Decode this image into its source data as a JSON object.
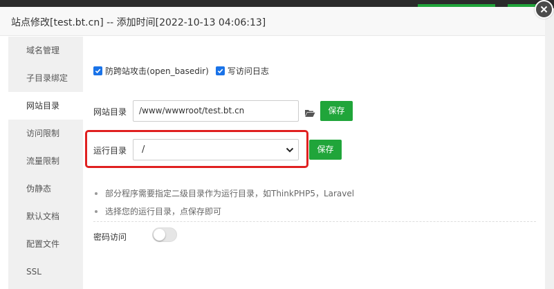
{
  "dialog": {
    "title": "站点修改[test.bt.cn] -- 添加时间[2022-10-13 04:06:13]"
  },
  "sidebar": {
    "items": [
      {
        "label": "域名管理"
      },
      {
        "label": "子目录绑定"
      },
      {
        "label": "网站目录"
      },
      {
        "label": "访问限制"
      },
      {
        "label": "流量限制"
      },
      {
        "label": "伪静态"
      },
      {
        "label": "默认文档"
      },
      {
        "label": "配置文件"
      },
      {
        "label": "SSL"
      }
    ],
    "active": "网站目录"
  },
  "content": {
    "options": {
      "anti_cross_site": {
        "label": "防跨站攻击(open_basedir)",
        "checked": true
      },
      "access_log": {
        "label": "写访问日志",
        "checked": true
      }
    },
    "site_dir": {
      "label": "网站目录",
      "value": "/www/wwwroot/test.bt.cn",
      "folder_icon": "folder-open-icon",
      "save_label": "保存"
    },
    "run_dir": {
      "label": "运行目录",
      "selected": "/",
      "save_label": "保存"
    },
    "tips": [
      "部分程序需要指定二级目录作为运行目录，如ThinkPHP5，Laravel",
      "选择您的运行目录，点保存即可"
    ],
    "password_access": {
      "label": "密码访问",
      "enabled": false
    }
  },
  "colors": {
    "accent_green": "#20a53a",
    "checkbox_blue": "#1a73e8",
    "highlight_red": "#e02020"
  }
}
